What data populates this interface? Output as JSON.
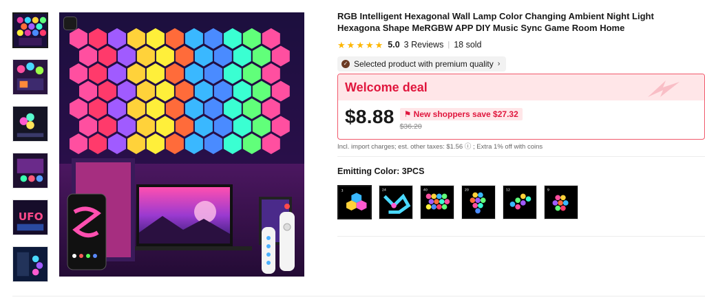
{
  "product": {
    "title": "RGB Intelligent Hexagonal Wall Lamp Color Changing Ambient Night Light Hexagona Shape MeRGBW APP DIY Music Sync Game Room Home",
    "rating": "5.0",
    "reviews": "3 Reviews",
    "sold": "18 sold",
    "quality_badge": "Selected product with premium quality"
  },
  "deal": {
    "title": "Welcome deal",
    "price": "$8.88",
    "save_text": "New shoppers save $27.32",
    "original_price": "$36.20"
  },
  "taxes_text": "Incl. import charges; est. other taxes: $1.56 ⓘ ; Extra 1% off with coins",
  "variant": {
    "label": "Emitting Color:",
    "selected": "3PCS",
    "options": [
      "3PCS",
      "24PCS",
      "40PCS",
      "20PCS",
      "12PCS",
      "9PCS"
    ]
  },
  "thumbnails": [
    "thumb-1",
    "thumb-2",
    "thumb-3",
    "thumb-4",
    "thumb-5",
    "thumb-6"
  ],
  "colors": {
    "accent_red": "#e0163d",
    "star": "#fdb600",
    "deal_bg": "#ffe6e8"
  }
}
